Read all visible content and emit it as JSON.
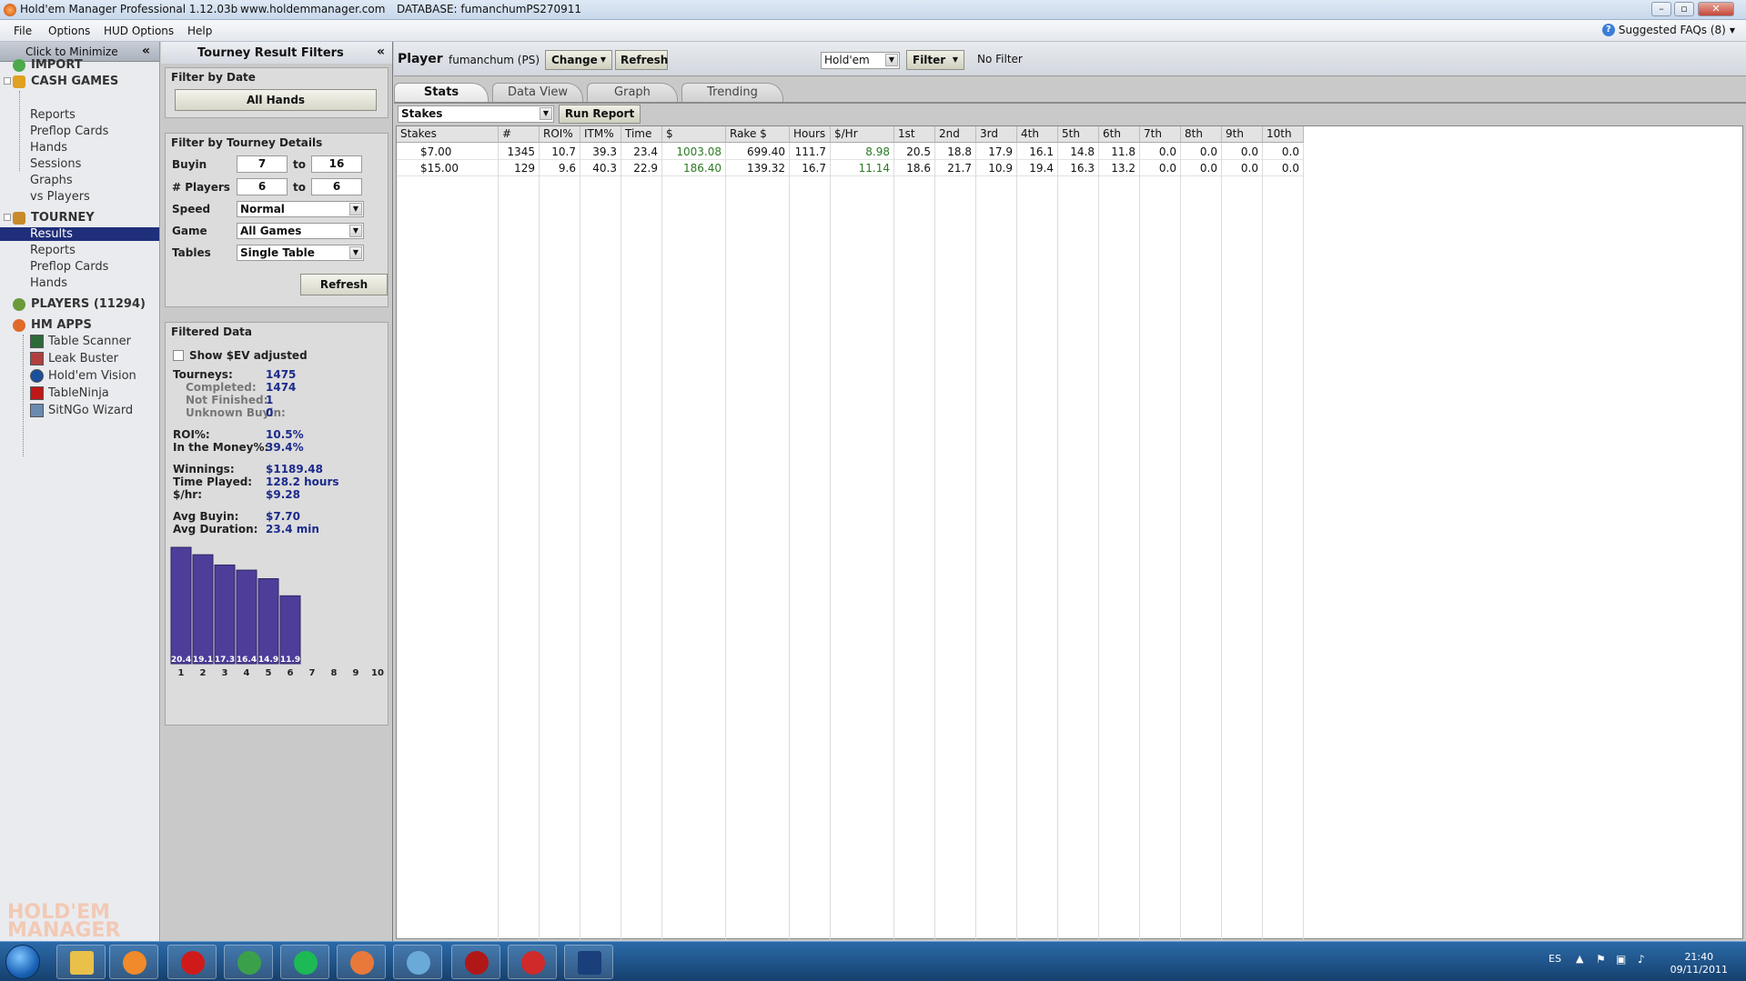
{
  "window": {
    "app_title": "Hold'em Manager Professional 1.12.03b",
    "website": "www.holdemmanager.com",
    "database": "DATABASE: fumanchumPS270911"
  },
  "menu": {
    "items": [
      "File",
      "Options",
      "HUD Options",
      "Help"
    ],
    "faq_label": "Suggested FAQs (8)"
  },
  "leftnav": {
    "minimize_label": "Click to Minimize",
    "import_label": "IMPORT",
    "cash_games_label": "CASH GAMES",
    "cash_items": [
      "Reports",
      "Preflop Cards",
      "Hands",
      "Sessions",
      "Graphs",
      "vs Players"
    ],
    "tourney_label": "TOURNEY",
    "tourney_items": [
      "Results",
      "Reports",
      "Preflop Cards",
      "Hands"
    ],
    "selected_item": "Results",
    "players_label": "PLAYERS (11294)",
    "hm_apps_label": "HM APPS",
    "apps": [
      "Table Scanner",
      "Leak Buster",
      "Hold'em Vision",
      "TableNinja",
      "SitNGo Wizard"
    ],
    "logo_line1": "HOLD'EM",
    "logo_line2": "MANAGER"
  },
  "filters": {
    "title": "Tourney Result Filters",
    "date_section_title": "Filter by Date",
    "all_hands_button": "All Hands",
    "details_section_title": "Filter by Tourney Details",
    "buyin_label": "Buyin",
    "buyin_from": "7",
    "buyin_to": "16",
    "players_label": "# Players",
    "players_from": "6",
    "players_to": "6",
    "to_label": "to",
    "speed_label": "Speed",
    "speed_value": "Normal",
    "game_label": "Game",
    "game_value": "All Games",
    "tables_label": "Tables",
    "tables_value": "Single Table",
    "refresh_button": "Refresh"
  },
  "filtered_data": {
    "title": "Filtered Data",
    "show_sev_label": "Show $EV adjusted",
    "show_sev_checked": false,
    "stats": [
      {
        "label": "Tourneys:",
        "value": "1475",
        "sub": false
      },
      {
        "label": "Completed:",
        "value": "1474",
        "sub": true
      },
      {
        "label": "Not Finished:",
        "value": "1",
        "sub": true
      },
      {
        "label": "Unknown Buyin:",
        "value": "0",
        "sub": true
      },
      {
        "label": "ROI%:",
        "value": "10.5%",
        "sub": false
      },
      {
        "label": "In the Money%:",
        "value": "39.4%",
        "sub": false
      },
      {
        "label": "Winnings:",
        "value": "$1189.48",
        "sub": false
      },
      {
        "label": "Time Played:",
        "value": "128.2 hours",
        "sub": false
      },
      {
        "label": "$/hr:",
        "value": "$9.28",
        "sub": false
      },
      {
        "label": "Avg Buyin:",
        "value": "$7.70",
        "sub": false
      },
      {
        "label": "Avg Duration:",
        "value": "23.4 min",
        "sub": false
      }
    ]
  },
  "chart_data": {
    "type": "bar",
    "categories": [
      "1",
      "2",
      "3",
      "4",
      "5",
      "6",
      "7",
      "8",
      "9",
      "10"
    ],
    "values": [
      20.4,
      19.1,
      17.3,
      16.4,
      14.9,
      11.9,
      0,
      0,
      0,
      0
    ],
    "value_labels": [
      "20.4",
      "19.1",
      "17.3",
      "16.4",
      "14.9",
      "11.9",
      "",
      "",
      "",
      ""
    ],
    "title": "",
    "xlabel": "",
    "ylabel": "",
    "ylim": [
      0,
      20.4
    ],
    "bar_color": "#4e3d99"
  },
  "playerbar": {
    "player_label": "Player",
    "player_name": "fumanchum (PS)",
    "change_button": "Change",
    "refresh_button": "Refresh",
    "game_select": "Hold'em",
    "filter_button": "Filter",
    "filter_status": "No Filter"
  },
  "tabs": [
    {
      "label": "Stats",
      "active": true
    },
    {
      "label": "Data View",
      "active": false
    },
    {
      "label": "Graph",
      "active": false
    },
    {
      "label": "Trending",
      "active": false
    }
  ],
  "report": {
    "group_select": "Stakes",
    "run_button": "Run Report"
  },
  "table": {
    "columns": [
      "Stakes",
      "#",
      "ROI%",
      "ITM%",
      "Time",
      "$",
      "Rake $",
      "Hours",
      "$/Hr",
      "1st",
      "2nd",
      "3rd",
      "4th",
      "5th",
      "6th",
      "7th",
      "8th",
      "9th",
      "10th"
    ],
    "rows": [
      [
        "$7.00",
        "1345",
        "10.7",
        "39.3",
        "23.4",
        "1003.08",
        "699.40",
        "111.7",
        "8.98",
        "20.5",
        "18.8",
        "17.9",
        "16.1",
        "14.8",
        "11.8",
        "0.0",
        "0.0",
        "0.0",
        "0.0"
      ],
      [
        "$15.00",
        "129",
        "9.6",
        "40.3",
        "22.9",
        "186.40",
        "139.32",
        "16.7",
        "11.14",
        "18.6",
        "21.7",
        "10.9",
        "19.4",
        "16.3",
        "13.2",
        "0.0",
        "0.0",
        "0.0",
        "0.0"
      ]
    ],
    "green_columns": [
      5,
      8
    ]
  },
  "taskbar": {
    "language": "ES",
    "time": "21:40",
    "date": "09/11/2011",
    "apps": [
      "explorer-icon",
      "media-player-icon",
      "opera-icon",
      "chrome-icon",
      "spotify-icon",
      "holdem-manager-icon",
      "chess-piece-icon",
      "tableninja-icon",
      "pokerstars-icon",
      "photoshop-icon"
    ]
  }
}
